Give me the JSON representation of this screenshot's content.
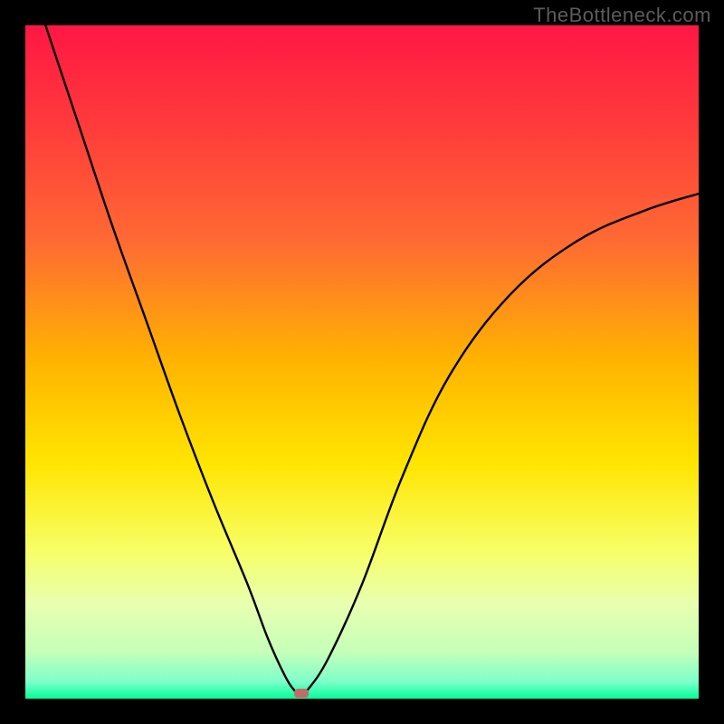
{
  "watermark": "TheBottleneck.com",
  "chart_data": {
    "type": "line",
    "title": "",
    "xlabel": "",
    "ylabel": "",
    "xlim": [
      0,
      100
    ],
    "ylim": [
      0,
      100
    ],
    "notes": "V-shaped bottleneck curve over vertical rainbow gradient (red top → green bottom). Left branch descends from top-left to minimum; right branch rises with decreasing slope toward upper right. Single marked minimum point near bottom.",
    "gradient_stops": [
      {
        "offset": 0.0,
        "color": "#ff1744"
      },
      {
        "offset": 0.15,
        "color": "#ff3b3b"
      },
      {
        "offset": 0.32,
        "color": "#ff6a33"
      },
      {
        "offset": 0.5,
        "color": "#ffb400"
      },
      {
        "offset": 0.65,
        "color": "#ffe500"
      },
      {
        "offset": 0.78,
        "color": "#f7ff66"
      },
      {
        "offset": 0.86,
        "color": "#e8ffb0"
      },
      {
        "offset": 0.93,
        "color": "#c6ffb8"
      },
      {
        "offset": 0.975,
        "color": "#7dffca"
      },
      {
        "offset": 1.0,
        "color": "#00ff99"
      }
    ],
    "series": [
      {
        "name": "bottleneck-curve",
        "x": [
          3,
          8,
          13,
          18,
          23,
          28,
          33,
          36,
          38.5,
          40,
          41,
          42,
          45,
          50,
          56,
          63,
          72,
          82,
          92,
          100
        ],
        "y": [
          100,
          85,
          70,
          56,
          42,
          29,
          17,
          9,
          3.5,
          1.2,
          0.8,
          1.4,
          6,
          17,
          33,
          48,
          60,
          68,
          72.5,
          75
        ]
      }
    ],
    "min_point": {
      "x": 41,
      "y": 0.8,
      "color": "#c26b6b"
    }
  }
}
